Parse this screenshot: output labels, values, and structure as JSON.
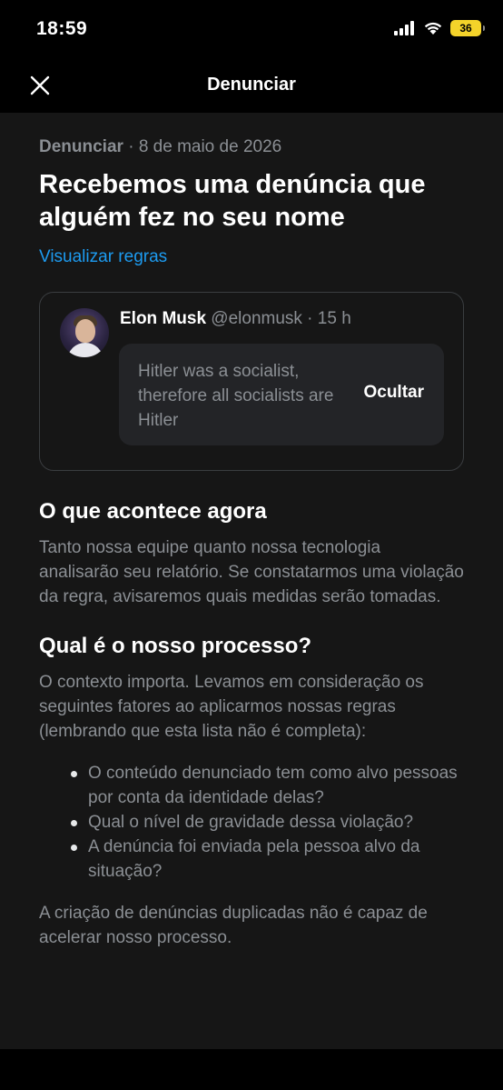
{
  "status": {
    "time": "18:59",
    "battery": "36"
  },
  "nav": {
    "title": "Denunciar"
  },
  "report": {
    "meta_label": "Denunciar",
    "meta_sep": " · ",
    "meta_date": "8 de maio de 2026",
    "headline": "Recebemos uma denúncia que alguém fez no seu nome",
    "rules_link": "Visualizar regras"
  },
  "tweet": {
    "name": "Elon Musk",
    "handle": "@elonmusk · 15 h",
    "text": "Hitler was a socialist, therefore all socialists are Hitler",
    "hide_label": "Ocultar"
  },
  "what_happens": {
    "title": "O que acontece agora",
    "body": "Tanto nossa equipe quanto nossa tecnologia analisarão seu relatório. Se constatarmos uma violação da regra, avisaremos quais medidas serão tomadas."
  },
  "process": {
    "title": "Qual é o nosso processo?",
    "intro": "O contexto importa. Levamos em consideração os seguintes fatores ao aplicarmos nossas regras (lembrando que esta lista não é completa):",
    "items": [
      "O conteúdo denunciado tem como alvo pessoas por conta da identidade delas?",
      "Qual o nível de gravidade dessa violação?",
      "A denúncia foi enviada pela pessoa alvo da situação?"
    ],
    "footer": "A criação de denúncias duplicadas não é capaz de acelerar nosso processo."
  }
}
